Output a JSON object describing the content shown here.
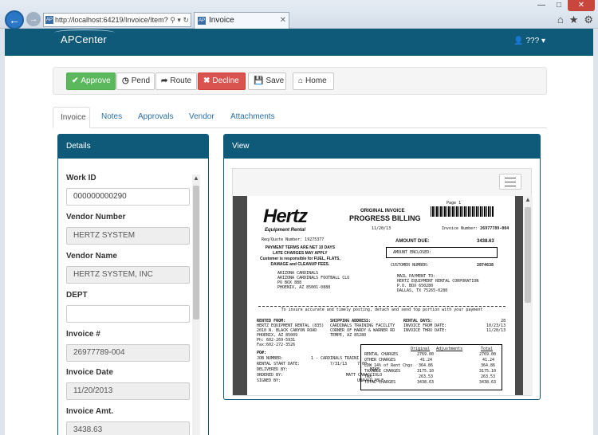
{
  "browser": {
    "url": "http://localhost:64219/Invoice/Item?wc",
    "tab_title": "Invoice",
    "favicon_text": "AP"
  },
  "app": {
    "logo": "APCenter",
    "user": "???"
  },
  "toolbar": {
    "approve": "Approve",
    "pend": "Pend",
    "route": "Route",
    "decline": "Decline",
    "save": "Save",
    "home": "Home"
  },
  "tabs": [
    "Invoice",
    "Notes",
    "Approvals",
    "Vendor",
    "Attachments"
  ],
  "details": {
    "title": "Details",
    "fields": [
      {
        "label": "Work ID",
        "value": "000000000290",
        "readonly": false
      },
      {
        "label": "Vendor Number",
        "value": "HERTZ SYSTEM",
        "readonly": true
      },
      {
        "label": "Vendor Name",
        "value": "HERTZ SYSTEM, INC",
        "readonly": true
      },
      {
        "label": "DEPT",
        "value": "",
        "readonly": false
      },
      {
        "label": "Invoice #",
        "value": "26977789-004",
        "readonly": true
      },
      {
        "label": "Invoice Date",
        "value": "11/20/2013",
        "readonly": true
      },
      {
        "label": "Invoice Amt.",
        "value": "3438.63",
        "readonly": true
      }
    ]
  },
  "view": {
    "title": "View",
    "document": {
      "logo": "Hertz",
      "logo_sub": "Equipment Rental",
      "page": "Page",
      "page_num": "1",
      "original_invoice": "ORIGINAL INVOICE",
      "progress_billing": "PROGRESS BILLING",
      "date": "11/20/13",
      "invoice_number_label": "Invoice Number:",
      "invoice_number": "26977789-004",
      "reqcode": "Req/Quote Number:  19275377",
      "terms": [
        "PAYMENT TERMS ARE NET 10 DAYS",
        "LATE CHARGES MAY APPLY",
        "Customer is responsible for FUEL, FLATS,",
        "DAMAGE and CLEANUP FEES."
      ],
      "amount_due_label": "AMOUNT DUE:",
      "amount_due": "3438.63",
      "amount_enclosed": "AMOUNT ENCLOSED:",
      "customer_number_label": "CUSTOMER NUMBER:",
      "customer_number": "2874638",
      "customer_address": [
        "ARIZONA CARDINALS",
        "ARIZONA CARDINALS FOOTBALL CLU",
        "PO BOX 888",
        "PHOENIX, AZ  85001-0888"
      ],
      "remit_address": [
        "MAIL PAYMENT TO:",
        "HERTZ EQUIPMENT RENTAL CORPORATION",
        "P.O. BOX 650280",
        "DALLAS, TX  75265-0280"
      ],
      "detach_line": "To insure accurate and timely posting, detach and send top portion with your payment",
      "rented_from": [
        "RENTED FROM:",
        "HERTZ EQUIPMENT RENTAL (835)",
        "2010 N. BLACK CANYON ROAD",
        "PHOENIX, AZ  85009",
        "Ph: 602-269-5931",
        "Fax:602-272-3526"
      ],
      "shipping": [
        "SHIPPING ADDRESS:",
        "CARDINALS TRAINING FACILITY",
        "CORNER OF HARDY & WARNER RD",
        "TEMPE, AZ  85280"
      ],
      "rental_days_label": "RENTAL DAYS:",
      "rental_days": "28",
      "invoice_from": "INVOICE FROM DATE:",
      "invoice_from_val": "10/23/13",
      "invoice_thru": "INVOICE THRU DATE:",
      "invoice_thru_val": "11/20/13",
      "po_label": "PO#:",
      "job_number": "JOB NUMBER:",
      "job_number_val": "1 - CARDINALS TRAINI",
      "rental_start": "RENTAL START DATE:",
      "rental_start_val": "7/31/13",
      "rental_start_time": "7:00",
      "delivered_by": "DELIVERED BY:",
      "delivered_by_val": "MIKE",
      "ordered_by": "ORDERED BY:",
      "ordered_by_val": "MATT CARACCIOLO",
      "signed_by": "SIGNED BY:",
      "signed_by_val": "UNAVAILABLE",
      "charges_header": [
        "Original",
        "Adjustments",
        "Total"
      ],
      "charges": [
        {
          "name": "RENTAL CHARGES",
          "orig": "2769.00",
          "total": "2769.00"
        },
        {
          "name": "OTHER CHARGES",
          "orig": "41.24",
          "total": "41.24"
        },
        {
          "name": "LDW 14% of Rent Chgs",
          "orig": "364.86",
          "total": "364.86"
        },
        {
          "name": "TAXABLE CHARGES",
          "orig": "3175.10",
          "total": "3175.10"
        },
        {
          "name": "TAX",
          "orig": "263.53",
          "total": "263.53"
        },
        {
          "name": "TOTAL CHARGES",
          "orig": "3438.63",
          "total": "3438.63"
        }
      ]
    }
  }
}
